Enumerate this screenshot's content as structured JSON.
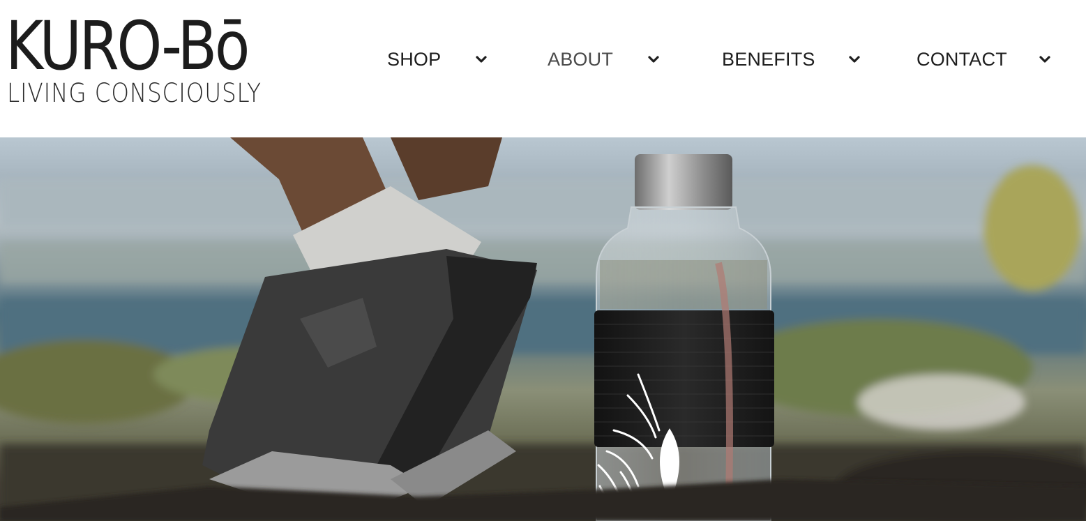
{
  "brand": {
    "name": "KURO-Bō",
    "tagline": "LIVING CONSCIOUSLY"
  },
  "nav": {
    "items": [
      {
        "label": "SHOP",
        "icon": "chevron-down-icon"
      },
      {
        "label": "ABOUT",
        "icon": "chevron-down-icon"
      },
      {
        "label": "BENEFITS",
        "icon": "chevron-down-icon"
      },
      {
        "label": "CONTACT",
        "icon": "chevron-down-icon"
      }
    ]
  },
  "hero": {
    "image": "hero-image",
    "colors": {
      "sky": "#b9c7d1",
      "water": "#50707f",
      "ground": "#3d3a33",
      "sleeve": "#1f1f1f",
      "cap": "#9a9a9a"
    }
  }
}
